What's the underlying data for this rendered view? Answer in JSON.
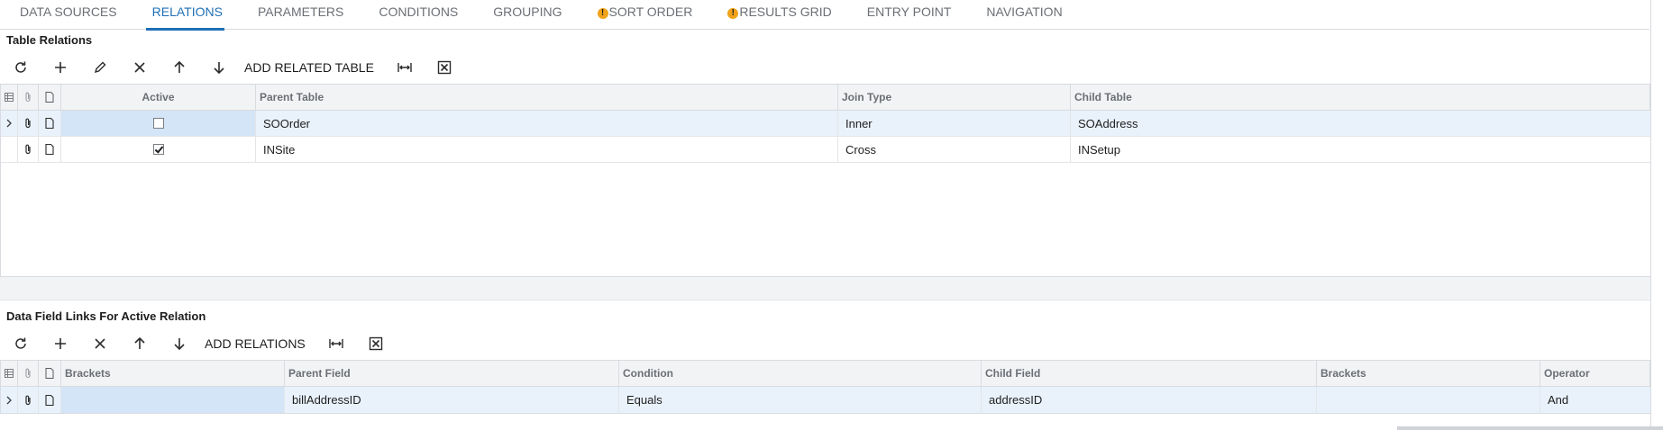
{
  "tabs": [
    {
      "label": "DATA SOURCES",
      "warning": false
    },
    {
      "label": "RELATIONS",
      "warning": false,
      "active": true
    },
    {
      "label": "PARAMETERS",
      "warning": false
    },
    {
      "label": "CONDITIONS",
      "warning": false
    },
    {
      "label": "GROUPING",
      "warning": false
    },
    {
      "label": "SORT ORDER",
      "warning": true
    },
    {
      "label": "RESULTS GRID",
      "warning": true
    },
    {
      "label": "ENTRY POINT",
      "warning": false
    },
    {
      "label": "NAVIGATION",
      "warning": false
    }
  ],
  "warning_glyph": "!",
  "relations": {
    "title": "Table Relations",
    "toolbar": {
      "refresh_icon": "refresh-icon",
      "add_icon": "plus-icon",
      "edit_icon": "pencil-icon",
      "delete_icon": "close-icon",
      "up_icon": "arrow-up-icon",
      "down_icon": "arrow-down-icon",
      "add_related_label": "ADD RELATED TABLE",
      "fit_icon": "fit-columns-icon",
      "excel_icon": "excel-export-icon"
    },
    "columns": {
      "active": "Active",
      "parent": "Parent Table",
      "join": "Join Type",
      "child": "Child Table"
    },
    "rows": [
      {
        "active": false,
        "parent": "SOOrder",
        "join": "Inner",
        "child": "SOAddress",
        "selected": true
      },
      {
        "active": true,
        "parent": "INSite",
        "join": "Cross",
        "child": "INSetup",
        "selected": false
      }
    ]
  },
  "links": {
    "title": "Data Field Links For Active Relation",
    "toolbar": {
      "add_relations_label": "ADD RELATIONS"
    },
    "columns": {
      "brackets_open": "Brackets",
      "parent_field": "Parent Field",
      "condition": "Condition",
      "child_field": "Child Field",
      "brackets_close": "Brackets",
      "operator": "Operator"
    },
    "rows": [
      {
        "brackets_open": "",
        "parent_field": "billAddressID",
        "condition": "Equals",
        "child_field": "addressID",
        "brackets_close": "",
        "operator": "And",
        "selected": true
      }
    ]
  },
  "colors": {
    "accent": "#1f6fb6",
    "warning": "#f0a31a",
    "selected_row": "#e9f2fb"
  }
}
